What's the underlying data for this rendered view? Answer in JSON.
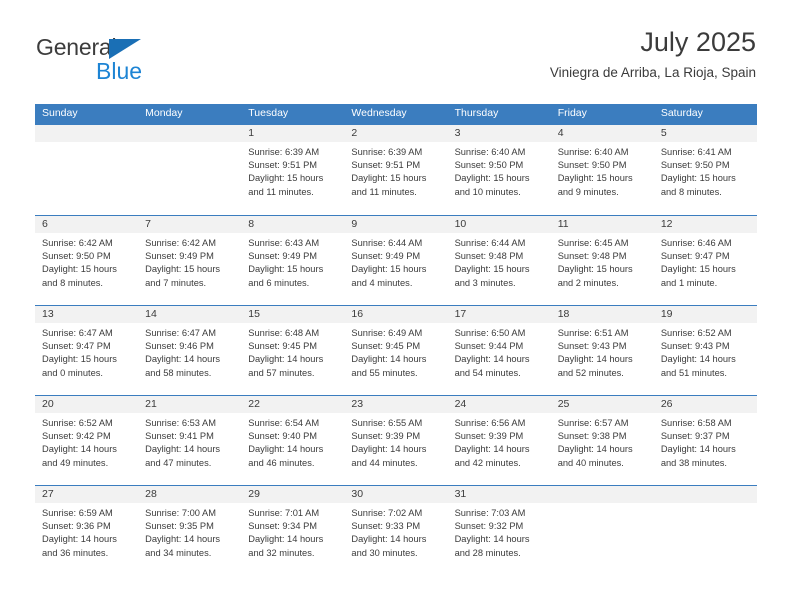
{
  "brand": {
    "name_top": "General",
    "name_bottom": "Blue"
  },
  "header": {
    "title": "July 2025",
    "subtitle": "Viniegra de Arriba, La Rioja, Spain"
  },
  "colors": {
    "header_blue": "#3b7dbf",
    "day_band": "#f2f2f2",
    "text": "#3b3b3b",
    "logo_blue": "#1d84d4"
  },
  "weekdays": [
    "Sunday",
    "Monday",
    "Tuesday",
    "Wednesday",
    "Thursday",
    "Friday",
    "Saturday"
  ],
  "weeks": [
    [
      {
        "day": "",
        "blank": true
      },
      {
        "day": "",
        "blank": true
      },
      {
        "day": "1",
        "sunrise": "Sunrise: 6:39 AM",
        "sunset": "Sunset: 9:51 PM",
        "daylight1": "Daylight: 15 hours",
        "daylight2": "and 11 minutes."
      },
      {
        "day": "2",
        "sunrise": "Sunrise: 6:39 AM",
        "sunset": "Sunset: 9:51 PM",
        "daylight1": "Daylight: 15 hours",
        "daylight2": "and 11 minutes."
      },
      {
        "day": "3",
        "sunrise": "Sunrise: 6:40 AM",
        "sunset": "Sunset: 9:50 PM",
        "daylight1": "Daylight: 15 hours",
        "daylight2": "and 10 minutes."
      },
      {
        "day": "4",
        "sunrise": "Sunrise: 6:40 AM",
        "sunset": "Sunset: 9:50 PM",
        "daylight1": "Daylight: 15 hours",
        "daylight2": "and 9 minutes."
      },
      {
        "day": "5",
        "sunrise": "Sunrise: 6:41 AM",
        "sunset": "Sunset: 9:50 PM",
        "daylight1": "Daylight: 15 hours",
        "daylight2": "and 8 minutes."
      }
    ],
    [
      {
        "day": "6",
        "sunrise": "Sunrise: 6:42 AM",
        "sunset": "Sunset: 9:50 PM",
        "daylight1": "Daylight: 15 hours",
        "daylight2": "and 8 minutes."
      },
      {
        "day": "7",
        "sunrise": "Sunrise: 6:42 AM",
        "sunset": "Sunset: 9:49 PM",
        "daylight1": "Daylight: 15 hours",
        "daylight2": "and 7 minutes."
      },
      {
        "day": "8",
        "sunrise": "Sunrise: 6:43 AM",
        "sunset": "Sunset: 9:49 PM",
        "daylight1": "Daylight: 15 hours",
        "daylight2": "and 6 minutes."
      },
      {
        "day": "9",
        "sunrise": "Sunrise: 6:44 AM",
        "sunset": "Sunset: 9:49 PM",
        "daylight1": "Daylight: 15 hours",
        "daylight2": "and 4 minutes."
      },
      {
        "day": "10",
        "sunrise": "Sunrise: 6:44 AM",
        "sunset": "Sunset: 9:48 PM",
        "daylight1": "Daylight: 15 hours",
        "daylight2": "and 3 minutes."
      },
      {
        "day": "11",
        "sunrise": "Sunrise: 6:45 AM",
        "sunset": "Sunset: 9:48 PM",
        "daylight1": "Daylight: 15 hours",
        "daylight2": "and 2 minutes."
      },
      {
        "day": "12",
        "sunrise": "Sunrise: 6:46 AM",
        "sunset": "Sunset: 9:47 PM",
        "daylight1": "Daylight: 15 hours",
        "daylight2": "and 1 minute."
      }
    ],
    [
      {
        "day": "13",
        "sunrise": "Sunrise: 6:47 AM",
        "sunset": "Sunset: 9:47 PM",
        "daylight1": "Daylight: 15 hours",
        "daylight2": "and 0 minutes."
      },
      {
        "day": "14",
        "sunrise": "Sunrise: 6:47 AM",
        "sunset": "Sunset: 9:46 PM",
        "daylight1": "Daylight: 14 hours",
        "daylight2": "and 58 minutes."
      },
      {
        "day": "15",
        "sunrise": "Sunrise: 6:48 AM",
        "sunset": "Sunset: 9:45 PM",
        "daylight1": "Daylight: 14 hours",
        "daylight2": "and 57 minutes."
      },
      {
        "day": "16",
        "sunrise": "Sunrise: 6:49 AM",
        "sunset": "Sunset: 9:45 PM",
        "daylight1": "Daylight: 14 hours",
        "daylight2": "and 55 minutes."
      },
      {
        "day": "17",
        "sunrise": "Sunrise: 6:50 AM",
        "sunset": "Sunset: 9:44 PM",
        "daylight1": "Daylight: 14 hours",
        "daylight2": "and 54 minutes."
      },
      {
        "day": "18",
        "sunrise": "Sunrise: 6:51 AM",
        "sunset": "Sunset: 9:43 PM",
        "daylight1": "Daylight: 14 hours",
        "daylight2": "and 52 minutes."
      },
      {
        "day": "19",
        "sunrise": "Sunrise: 6:52 AM",
        "sunset": "Sunset: 9:43 PM",
        "daylight1": "Daylight: 14 hours",
        "daylight2": "and 51 minutes."
      }
    ],
    [
      {
        "day": "20",
        "sunrise": "Sunrise: 6:52 AM",
        "sunset": "Sunset: 9:42 PM",
        "daylight1": "Daylight: 14 hours",
        "daylight2": "and 49 minutes."
      },
      {
        "day": "21",
        "sunrise": "Sunrise: 6:53 AM",
        "sunset": "Sunset: 9:41 PM",
        "daylight1": "Daylight: 14 hours",
        "daylight2": "and 47 minutes."
      },
      {
        "day": "22",
        "sunrise": "Sunrise: 6:54 AM",
        "sunset": "Sunset: 9:40 PM",
        "daylight1": "Daylight: 14 hours",
        "daylight2": "and 46 minutes."
      },
      {
        "day": "23",
        "sunrise": "Sunrise: 6:55 AM",
        "sunset": "Sunset: 9:39 PM",
        "daylight1": "Daylight: 14 hours",
        "daylight2": "and 44 minutes."
      },
      {
        "day": "24",
        "sunrise": "Sunrise: 6:56 AM",
        "sunset": "Sunset: 9:39 PM",
        "daylight1": "Daylight: 14 hours",
        "daylight2": "and 42 minutes."
      },
      {
        "day": "25",
        "sunrise": "Sunrise: 6:57 AM",
        "sunset": "Sunset: 9:38 PM",
        "daylight1": "Daylight: 14 hours",
        "daylight2": "and 40 minutes."
      },
      {
        "day": "26",
        "sunrise": "Sunrise: 6:58 AM",
        "sunset": "Sunset: 9:37 PM",
        "daylight1": "Daylight: 14 hours",
        "daylight2": "and 38 minutes."
      }
    ],
    [
      {
        "day": "27",
        "sunrise": "Sunrise: 6:59 AM",
        "sunset": "Sunset: 9:36 PM",
        "daylight1": "Daylight: 14 hours",
        "daylight2": "and 36 minutes."
      },
      {
        "day": "28",
        "sunrise": "Sunrise: 7:00 AM",
        "sunset": "Sunset: 9:35 PM",
        "daylight1": "Daylight: 14 hours",
        "daylight2": "and 34 minutes."
      },
      {
        "day": "29",
        "sunrise": "Sunrise: 7:01 AM",
        "sunset": "Sunset: 9:34 PM",
        "daylight1": "Daylight: 14 hours",
        "daylight2": "and 32 minutes."
      },
      {
        "day": "30",
        "sunrise": "Sunrise: 7:02 AM",
        "sunset": "Sunset: 9:33 PM",
        "daylight1": "Daylight: 14 hours",
        "daylight2": "and 30 minutes."
      },
      {
        "day": "31",
        "sunrise": "Sunrise: 7:03 AM",
        "sunset": "Sunset: 9:32 PM",
        "daylight1": "Daylight: 14 hours",
        "daylight2": "and 28 minutes."
      },
      {
        "day": "",
        "blank": true
      },
      {
        "day": "",
        "blank": true
      }
    ]
  ]
}
